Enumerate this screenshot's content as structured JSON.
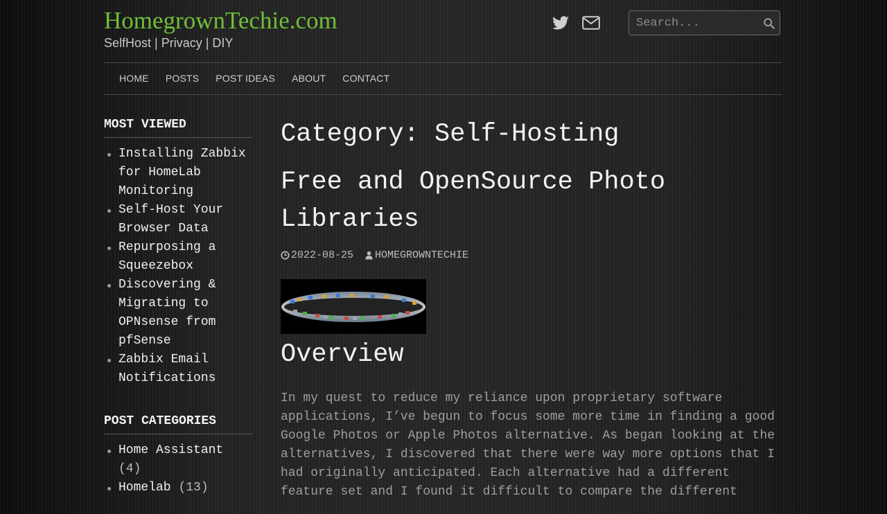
{
  "header": {
    "site_title": "HomegrownTechie.com",
    "tagline": "SelfHost | Privacy | DIY",
    "social": [
      {
        "icon": "twitter-icon"
      },
      {
        "icon": "mail-icon"
      }
    ],
    "search": {
      "placeholder": "Search...",
      "icon": "search-icon"
    }
  },
  "nav": {
    "items": [
      {
        "label": "HOME"
      },
      {
        "label": "POSTS"
      },
      {
        "label": "POST IDEAS"
      },
      {
        "label": "ABOUT"
      },
      {
        "label": "CONTACT"
      }
    ]
  },
  "sidebar": {
    "most_viewed": {
      "title": "MOST VIEWED",
      "items": [
        {
          "label": "Installing Zabbix for HomeLab Monitoring"
        },
        {
          "label": "Self-Host Your Browser Data"
        },
        {
          "label": "Repurposing a Squeezebox"
        },
        {
          "label": "Discovering & Migrating to OPNsense from pfSense"
        },
        {
          "label": "Zabbix Email Notifications"
        }
      ]
    },
    "categories": {
      "title": "POST CATEGORIES",
      "items": [
        {
          "label": "Home Assistant",
          "count": "(4)"
        },
        {
          "label": "Homelab",
          "count": "(13)"
        }
      ]
    }
  },
  "main": {
    "category_title": "Category: Self-Hosting",
    "post": {
      "title": "Free and OpenSource Photo Libraries",
      "date": "2022-08-25",
      "author": "HOMEGROWNTECHIE",
      "date_icon": "clock-icon",
      "author_icon": "user-icon",
      "section_heading": "Overview",
      "excerpt": "In my quest to reduce my reliance upon proprietary software applications, I’ve begun to focus some more time in finding a good Google Photos or Apple Photos alternative. As began looking at the alternatives, I discovered that there were way more options that I had originally anticipated. Each alternative had a different feature set and I found it difficult to compare the different"
    }
  },
  "colors": {
    "accent": "#6fbf3a",
    "background": "#1a1a1a",
    "text": "#e6e6e6",
    "muted": "#9e9e9e"
  }
}
